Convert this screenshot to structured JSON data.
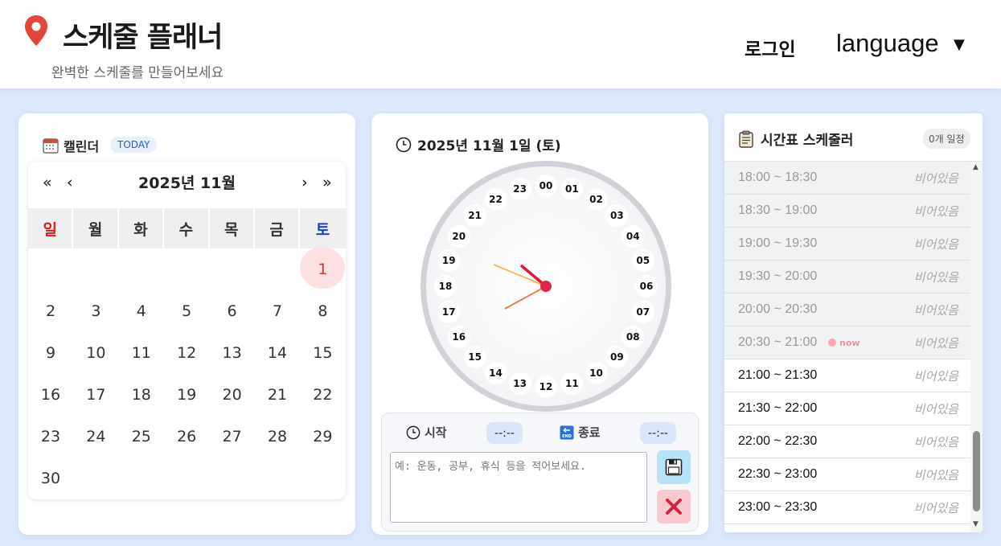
{
  "header": {
    "title": "스케줄 플래너",
    "subtitle": "완벽한 스케줄를 만들어보세요",
    "login": "로그인",
    "language": "language",
    "language_caret": "▼"
  },
  "calendar": {
    "title": "캘린더",
    "today_chip": "TODAY",
    "month_label": "2025년 11월",
    "nav": {
      "prev_year": "«",
      "prev_month": "‹",
      "next_month": "›",
      "next_year": "»"
    },
    "weekdays": [
      "일",
      "월",
      "화",
      "수",
      "목",
      "금",
      "토"
    ],
    "weekday_colors": {
      "sunday": "#e01818",
      "saturday": "#1b3fd6"
    },
    "selected_day": 1,
    "days": [
      "1",
      "2",
      "3",
      "4",
      "5",
      "6",
      "7",
      "8",
      "9",
      "10",
      "11",
      "12",
      "13",
      "14",
      "15",
      "16",
      "17",
      "18",
      "19",
      "20",
      "21",
      "22",
      "23",
      "24",
      "25",
      "26",
      "27",
      "28",
      "29",
      "30"
    ],
    "first_weekday_index": 6
  },
  "clock": {
    "date_title": "2025년 11월 1일 (토)",
    "hour_numbers": [
      "00",
      "01",
      "02",
      "03",
      "04",
      "05",
      "06",
      "07",
      "08",
      "09",
      "10",
      "11",
      "12",
      "13",
      "14",
      "15",
      "16",
      "17",
      "18",
      "19",
      "20",
      "21",
      "22",
      "23"
    ],
    "range": {
      "start_label": "시작",
      "start_value": "--:--",
      "end_label": "종료",
      "end_value": "--:--",
      "memo_placeholder": "예: 운동, 공부, 휴식 등을 적어보세요."
    },
    "hand_colors": {
      "hour": "#e01830",
      "minute": "#f07a50",
      "second": "#f0b030"
    }
  },
  "schedule": {
    "title": "시간표 스케줄러",
    "count_chip": "0개 일정",
    "now_label": "now",
    "rows": [
      {
        "time": "18:00 ~ 18:30",
        "status": "비어있음",
        "past": true
      },
      {
        "time": "18:30 ~ 19:00",
        "status": "비어있음",
        "past": true
      },
      {
        "time": "19:00 ~ 19:30",
        "status": "비어있음",
        "past": true
      },
      {
        "time": "19:30 ~ 20:00",
        "status": "비어있음",
        "past": true
      },
      {
        "time": "20:00 ~ 20:30",
        "status": "비어있음",
        "past": true
      },
      {
        "time": "20:30 ~ 21:00",
        "status": "비어있음",
        "past": true,
        "now": true
      },
      {
        "time": "21:00 ~ 21:30",
        "status": "비어있음",
        "past": false
      },
      {
        "time": "21:30 ~ 22:00",
        "status": "비어있음",
        "past": false
      },
      {
        "time": "22:00 ~ 22:30",
        "status": "비어있음",
        "past": false
      },
      {
        "time": "22:30 ~ 23:00",
        "status": "비어있음",
        "past": false
      },
      {
        "time": "23:00 ~ 23:30",
        "status": "비어있음",
        "past": false
      }
    ]
  }
}
